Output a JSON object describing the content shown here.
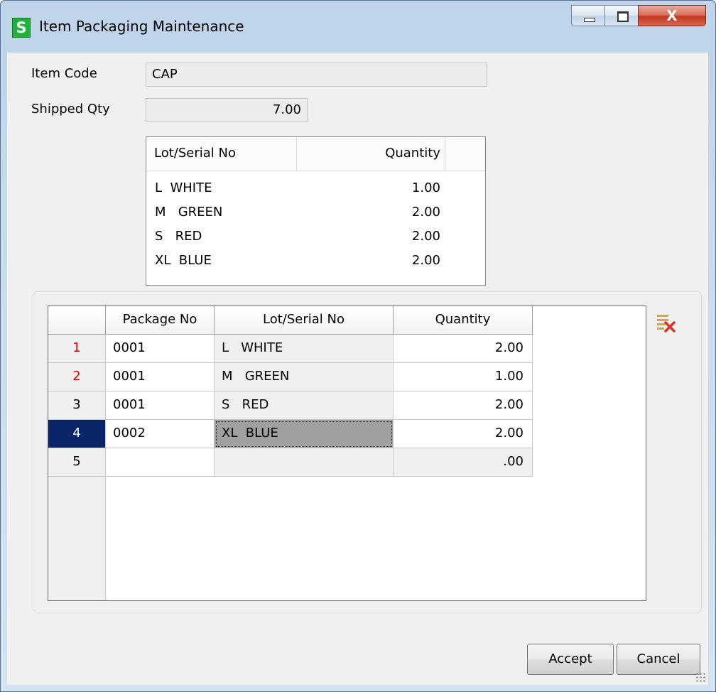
{
  "window": {
    "title": "Item Packaging Maintenance",
    "app_icon_letter": "S",
    "close_glyph": "X"
  },
  "header": {
    "item_code_label": "Item Code",
    "item_code_value": "CAP",
    "shipped_qty_label": "Shipped Qty",
    "shipped_qty_value": "7.00"
  },
  "lot_list": {
    "columns": [
      "Lot/Serial No",
      "Quantity"
    ],
    "rows": [
      {
        "lot": "L  WHITE",
        "qty": "1.00"
      },
      {
        "lot": "M   GREEN",
        "qty": "2.00"
      },
      {
        "lot": "S   RED",
        "qty": "2.00"
      },
      {
        "lot": "XL  BLUE",
        "qty": "2.00"
      }
    ]
  },
  "packages": {
    "columns": [
      "",
      "Package No",
      "Lot/Serial No",
      "Quantity"
    ],
    "rows": [
      {
        "num": "1",
        "package": "0001",
        "lot": "L   WHITE",
        "qty": "2.00",
        "num_color": "red"
      },
      {
        "num": "2",
        "package": "0001",
        "lot": "M   GREEN",
        "qty": "1.00",
        "num_color": "red"
      },
      {
        "num": "3",
        "package": "0001",
        "lot": "S   RED",
        "qty": "2.00"
      },
      {
        "num": "4",
        "package": "0002",
        "lot": "XL  BLUE",
        "qty": "2.00",
        "selected": true
      },
      {
        "num": "5",
        "package": "",
        "lot": "",
        "qty": ".00"
      }
    ],
    "delete_icon": "delete-rows-icon"
  },
  "buttons": {
    "accept": "Accept",
    "cancel": "Cancel"
  },
  "colors": {
    "selected_row": "#0a246a",
    "error_number": "#e00000",
    "app_icon_green": "#1db43a"
  }
}
